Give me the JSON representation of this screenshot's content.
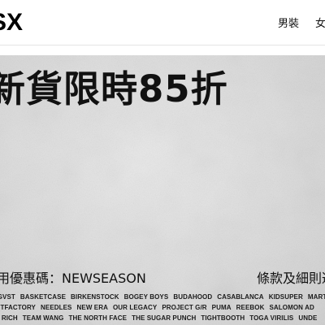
{
  "header": {
    "logo_text": "SX",
    "nav_items": [
      {
        "label": "男裝"
      },
      {
        "label": "女裝"
      }
    ]
  },
  "banner": {
    "headline": "新貨限時85折",
    "promo_code_text": "用優惠碼：NEWSEASON",
    "terms_text": "條款及細則適",
    "brand_rows": [
      [
        "AVGVST",
        "BASKETCASE",
        "BIRKENSTOCK",
        "BOGEY BOYS",
        "BUDAHOOD",
        "CASABLANCA",
        "KIDSUPER",
        "MARTINE"
      ],
      [
        "IGHTFACTORY",
        "NEEDLES",
        "NEW ERA",
        "OUR LEGACY",
        "PROJECT G/R",
        "PUMA",
        "REEBOK",
        "SALOMON AD"
      ],
      [
        "Y & RICH",
        "TEAM WANG",
        "THE NORTH FACE",
        "THE SUGAR PUNCH",
        "TIGHTBOOTH",
        "TOGA VIRILIS",
        "UNDE"
      ]
    ]
  }
}
